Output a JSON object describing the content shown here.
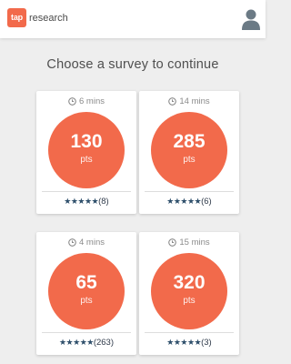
{
  "colors": {
    "accent": "#f26a4b",
    "logo_bg": "#f26a4b",
    "star": "#2d4e6a",
    "background": "#eeeeee"
  },
  "header": {
    "logo_mark": "tap",
    "logo_word": "research",
    "user_icon": "user-icon"
  },
  "main": {
    "title": "Choose a survey to continue"
  },
  "surveys": [
    {
      "time": "6 mins",
      "points": "130",
      "unit": "pts",
      "stars": "★★★★★",
      "reviews": "(8)",
      "rating": 5
    },
    {
      "time": "14 mins",
      "points": "285",
      "unit": "pts",
      "stars": "★★★★★",
      "reviews": "(6)",
      "rating": 5
    },
    {
      "time": "4 mins",
      "points": "65",
      "unit": "pts",
      "stars": "★★★★★",
      "reviews": "(263)",
      "rating": 5
    },
    {
      "time": "15 mins",
      "points": "320",
      "unit": "pts",
      "stars": "★★★★★",
      "reviews": "(3)",
      "rating": 5
    }
  ]
}
